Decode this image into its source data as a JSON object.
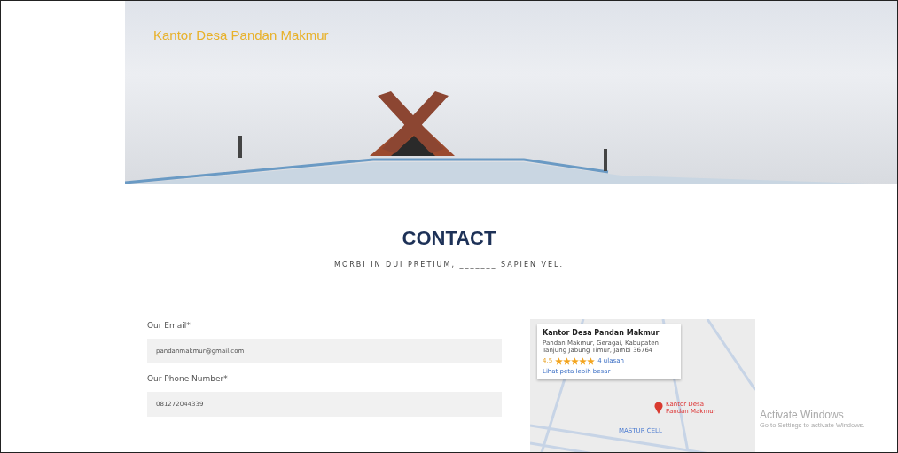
{
  "header": {
    "brand": "Kantor Desa Pandan Makmur"
  },
  "section": {
    "title": "CONTACT",
    "subtitle": "MORBI IN DUI PRETIUM, _______ SAPIEN VEL."
  },
  "fields": [
    {
      "label": "Our Email*",
      "value": "pandanmakmur@gmail.com"
    },
    {
      "label": "Our Phone Number*",
      "value": "081272044339"
    }
  ],
  "map": {
    "card_title": "Kantor Desa Pandan Makmur",
    "address": "Pandan Makmur, Geragai, Kabupaten Tanjung Jabung Timur, Jambi 36764",
    "rating": "4,5",
    "stars": 5,
    "reviews": "4 ulasan",
    "link": "Lihat peta lebih besar",
    "pin_label": "Kantor Desa Pandan Makmur",
    "place_label": "MASTUR CELL"
  },
  "os_notice": {
    "title": "Activate Windows",
    "text": "Go to Settings to activate Windows."
  }
}
